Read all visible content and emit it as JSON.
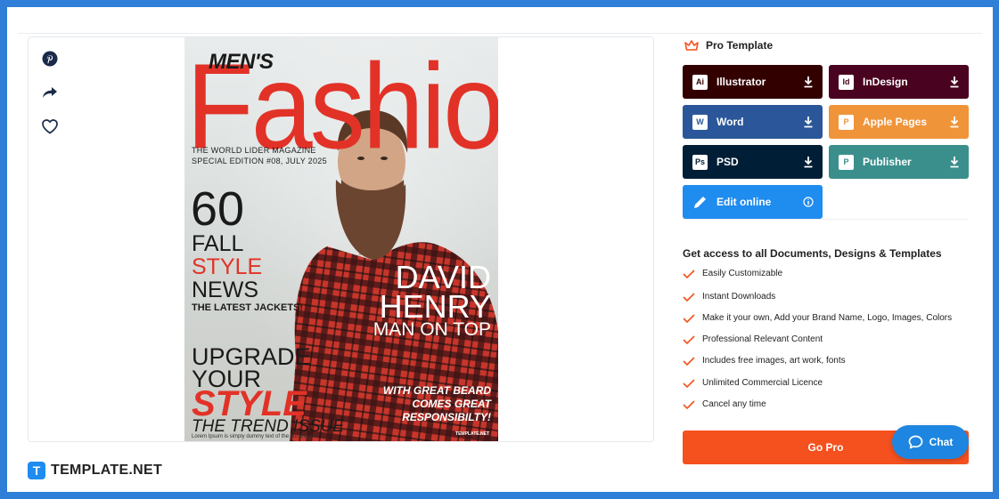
{
  "cover": {
    "mens": "MEN'S",
    "fashion": "Fashion",
    "tagline1": "THE WORLD LIDER MAGAZINE",
    "tagline2": "SPECIAL EDITION #08, JULY 2025",
    "num": "60",
    "fall": "FALL",
    "style": "STYLE",
    "news": "NEWS",
    "jackets": "THE LATEST JACKETS!",
    "upgrade": "UPGRADE",
    "your": "YOUR",
    "style2": "STYLE",
    "trend": "THE TREND ISSUE",
    "lorem": "Lorem Ipsum is simply dummy text of the printing and",
    "david": "DAVID",
    "henry": "HENRY",
    "man_on_top": "MAN ON TOP",
    "beard1": "WITH GREAT BEARD",
    "beard2": "COMES GREAT",
    "beard3": "RESPONSIBILTY!",
    "brand": "TEMPLATE.NET"
  },
  "logo": {
    "text": "TEMPLATE.NET",
    "mark": "T"
  },
  "pro": {
    "title": "Pro Template"
  },
  "formats": [
    {
      "label": "Illustrator",
      "icon": "Ai",
      "color": "#330000"
    },
    {
      "label": "InDesign",
      "icon": "Id",
      "color": "#49021f"
    },
    {
      "label": "Word",
      "icon": "W",
      "color": "#2b579a"
    },
    {
      "label": "Apple Pages",
      "icon": "P",
      "color": "#f0943a"
    },
    {
      "label": "PSD",
      "icon": "Ps",
      "color": "#001e36"
    },
    {
      "label": "Publisher",
      "icon": "P",
      "color": "#3a8f8c"
    },
    {
      "label": "Edit online",
      "icon": "pencil-icon",
      "color": "#1f8cef"
    }
  ],
  "access": {
    "title": "Get access to all Documents, Designs & Templates",
    "features": [
      "Easily Customizable",
      "Instant Downloads",
      "Make it your own, Add your Brand Name, Logo, Images, Colors",
      "Professional Relevant Content",
      "Includes free images, art work, fonts",
      "Unlimited Commercial Licence",
      "Cancel any time"
    ]
  },
  "gopro": {
    "label": "Go Pro"
  },
  "chat": {
    "label": "Chat"
  },
  "colors": {
    "accent": "#f4511e",
    "brand_blue": "#1f8cef",
    "frame": "#2f7fd8"
  }
}
